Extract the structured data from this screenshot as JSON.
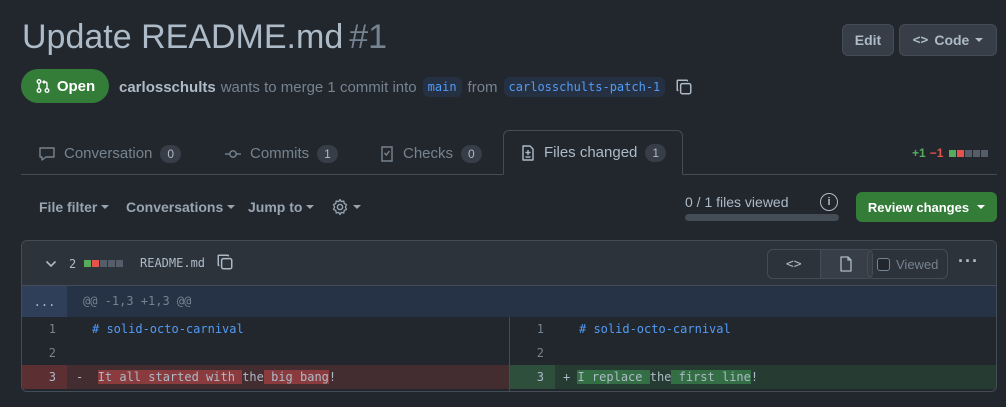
{
  "pr": {
    "title": "Update README.md",
    "number": "#1",
    "state": "Open",
    "author": "carlosschults",
    "merge_text": "wants to merge 1 commit into",
    "base_branch": "main",
    "from_text": "from",
    "head_branch": "carlosschults-patch-1"
  },
  "header": {
    "edit_label": "Edit",
    "code_label": "Code"
  },
  "tabs": [
    {
      "label": "Conversation",
      "count": "0"
    },
    {
      "label": "Commits",
      "count": "1"
    },
    {
      "label": "Checks",
      "count": "0"
    },
    {
      "label": "Files changed",
      "count": "1"
    }
  ],
  "diffstat": {
    "additions": "+1",
    "deletions": "−1"
  },
  "toolbar": {
    "file_filter": "File filter",
    "conversations": "Conversations",
    "jump_to": "Jump to",
    "viewed_progress": "0 / 1 files viewed",
    "viewed_fraction": 0,
    "review_label": "Review changes"
  },
  "file": {
    "change_count": "2",
    "name": "README.md",
    "viewed_label": "Viewed",
    "expand_label": "...",
    "hunk_header": "@@ -1,3 +1,3 @@",
    "left_lines": [
      {
        "num": "1",
        "code": "# solid-octo-carnival"
      },
      {
        "num": "2",
        "code": ""
      },
      {
        "num": "3",
        "marker": "-",
        "parts": [
          "It all started with ",
          "the",
          " big bang",
          "!"
        ]
      }
    ],
    "right_lines": [
      {
        "num": "1",
        "code": "# solid-octo-carnival"
      },
      {
        "num": "2",
        "code": ""
      },
      {
        "num": "3",
        "marker": "+",
        "parts": [
          "I replace ",
          "the",
          " first line",
          "!"
        ]
      }
    ]
  },
  "colors": {
    "background": "#22272e",
    "accent_green": "#347d39",
    "addition": "#57ab5a",
    "deletion": "#e5534b",
    "link": "#539bf5"
  }
}
